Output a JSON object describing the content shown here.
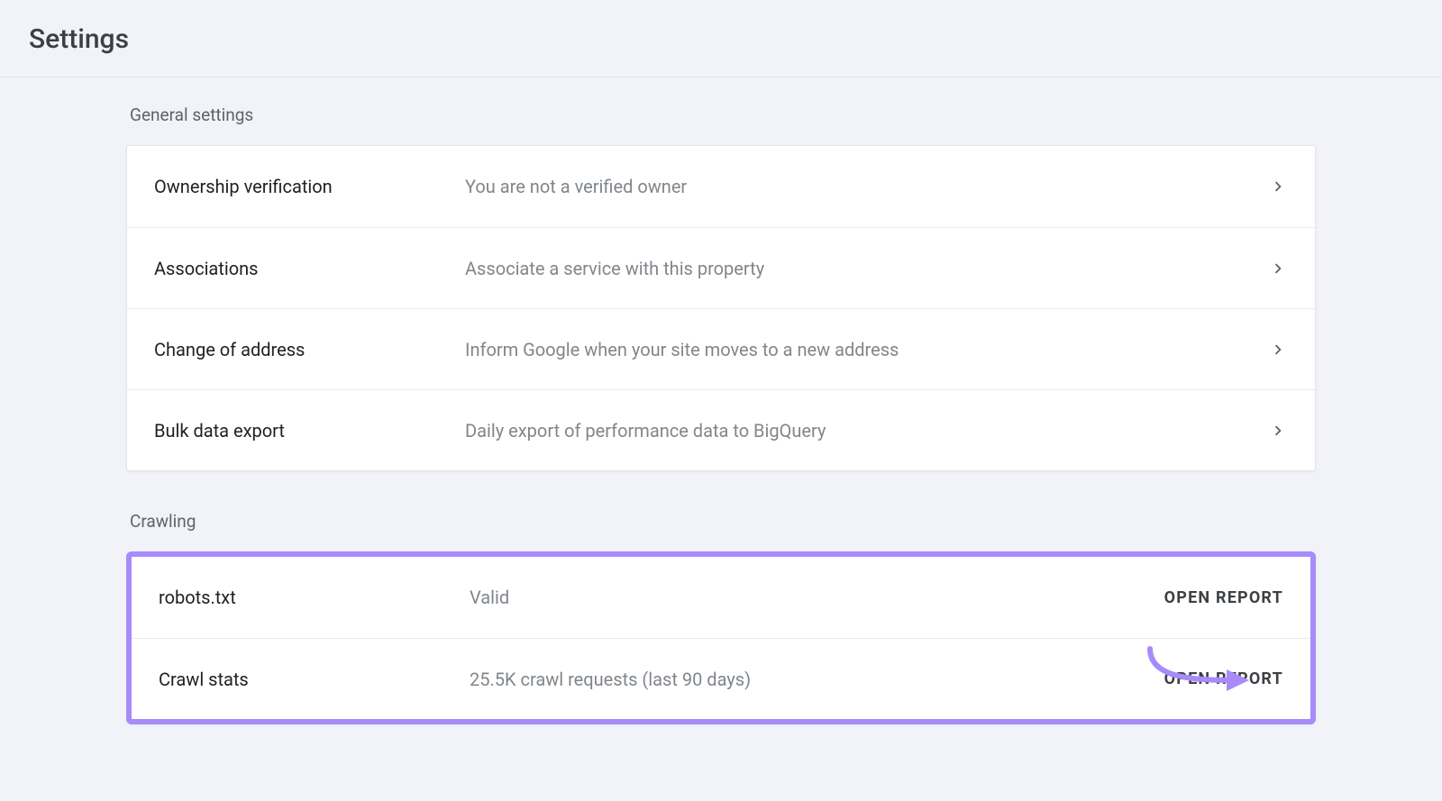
{
  "page": {
    "title": "Settings"
  },
  "sections": {
    "general": {
      "label": "General settings",
      "rows": [
        {
          "label": "Ownership verification",
          "desc": "You are not a verified owner"
        },
        {
          "label": "Associations",
          "desc": "Associate a service with this property"
        },
        {
          "label": "Change of address",
          "desc": "Inform Google when your site moves to a new address"
        },
        {
          "label": "Bulk data export",
          "desc": "Daily export of performance data to BigQuery"
        }
      ]
    },
    "crawling": {
      "label": "Crawling",
      "rows": [
        {
          "label": "robots.txt",
          "desc": "Valid",
          "action": "OPEN REPORT"
        },
        {
          "label": "Crawl stats",
          "desc": "25.5K crawl requests (last 90 days)",
          "action": "OPEN REPORT"
        }
      ]
    }
  }
}
